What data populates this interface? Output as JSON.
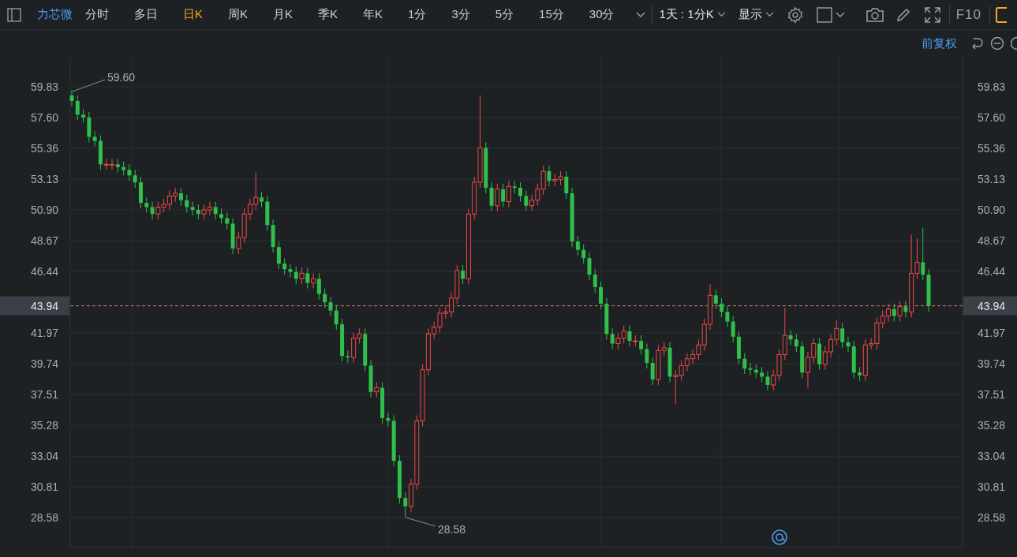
{
  "toolbar": {
    "stock_name": "力芯微",
    "tabs": [
      {
        "label": "分时",
        "selected": false
      },
      {
        "label": "多日",
        "selected": false
      },
      {
        "label": "日K",
        "selected": true
      },
      {
        "label": "周K",
        "selected": false
      },
      {
        "label": "月K",
        "selected": false
      },
      {
        "label": "季K",
        "selected": false
      },
      {
        "label": "年K",
        "selected": false
      },
      {
        "label": "1分",
        "selected": false
      },
      {
        "label": "3分",
        "selected": false
      },
      {
        "label": "5分",
        "selected": false
      },
      {
        "label": "15分",
        "selected": false
      },
      {
        "label": "30分",
        "selected": false
      }
    ],
    "dropdowns": [
      "1天 : 1分K",
      "显示"
    ],
    "f10": "F10"
  },
  "adjustment": "前复权",
  "chart": {
    "price_labels": [
      "43.94"
    ],
    "right_axis_labels": [
      "59.83",
      "57.60",
      "55.36",
      "53.13",
      "50.90",
      "48.67",
      "46.44",
      "41.97",
      "39.74",
      "37.51",
      "35.28",
      "33.04",
      "30.81",
      "28.58"
    ],
    "chart_data": {
      "type": "candlestick",
      "grid": true,
      "yticks": [
        {
          "value": 59.83,
          "label": "59.83"
        },
        {
          "value": 57.6,
          "label": "57.60"
        },
        {
          "value": 55.36,
          "label": "55.36"
        },
        {
          "value": 53.13,
          "label": "53.13"
        },
        {
          "value": 50.9,
          "label": "50.90"
        },
        {
          "value": 48.67,
          "label": "48.67"
        },
        {
          "value": 46.44,
          "label": "46.44"
        },
        {
          "value": 41.97,
          "label": "41.97"
        },
        {
          "value": 39.74,
          "label": "39.74"
        },
        {
          "value": 37.51,
          "label": "37.51"
        },
        {
          "value": 35.28,
          "label": "35.28"
        },
        {
          "value": 33.04,
          "label": "33.04"
        },
        {
          "value": 30.81,
          "label": "30.81"
        },
        {
          "value": 28.58,
          "label": "28.58"
        }
      ],
      "ref_lines": [
        {
          "axis": "y",
          "value": 43.94,
          "label": "43.94",
          "color": "#c8856a"
        }
      ],
      "ylim": [
        26.41,
        62.0
      ],
      "ohlc": [
        [
          59.2,
          59.6,
          58.4,
          58.8
        ],
        [
          58.8,
          59.2,
          57.4,
          57.8
        ],
        [
          57.8,
          58.2,
          57.2,
          57.6
        ],
        [
          57.6,
          58.0,
          55.8,
          56.2
        ],
        [
          56.2,
          56.6,
          55.5,
          55.9
        ],
        [
          55.9,
          56.3,
          53.8,
          54.2
        ],
        [
          54.2,
          54.6,
          53.8,
          54.2
        ],
        [
          54.2,
          54.6,
          53.8,
          54.2
        ],
        [
          54.2,
          54.6,
          53.6,
          54.0
        ],
        [
          54.0,
          54.4,
          53.4,
          53.8
        ],
        [
          53.8,
          54.2,
          53.0,
          53.4
        ],
        [
          53.4,
          53.8,
          52.5,
          52.9
        ],
        [
          52.9,
          53.3,
          51.0,
          51.4
        ],
        [
          51.4,
          51.8,
          50.7,
          51.1
        ],
        [
          51.1,
          51.5,
          50.2,
          50.6
        ],
        [
          50.6,
          51.5,
          50.2,
          51.1
        ],
        [
          51.1,
          51.7,
          50.7,
          51.3
        ],
        [
          51.3,
          52.3,
          50.9,
          51.9
        ],
        [
          51.9,
          52.5,
          51.5,
          52.1
        ],
        [
          52.1,
          52.5,
          51.2,
          51.6
        ],
        [
          51.6,
          52.0,
          50.7,
          51.1
        ],
        [
          51.1,
          51.5,
          50.5,
          50.9
        ],
        [
          50.9,
          51.3,
          50.2,
          50.6
        ],
        [
          50.6,
          51.3,
          50.2,
          50.9
        ],
        [
          50.9,
          51.5,
          50.5,
          51.1
        ],
        [
          51.1,
          51.5,
          50.2,
          50.6
        ],
        [
          50.6,
          51.0,
          49.9,
          50.3
        ],
        [
          50.3,
          50.7,
          49.5,
          49.9
        ],
        [
          49.9,
          50.3,
          47.7,
          48.1
        ],
        [
          48.1,
          49.3,
          47.7,
          48.9
        ],
        [
          48.9,
          51.0,
          48.5,
          50.6
        ],
        [
          50.6,
          51.7,
          50.2,
          51.3
        ],
        [
          51.3,
          53.6,
          50.9,
          51.8
        ],
        [
          51.8,
          52.2,
          51.1,
          51.5
        ],
        [
          51.5,
          51.9,
          49.4,
          49.8
        ],
        [
          49.8,
          50.2,
          47.8,
          48.2
        ],
        [
          48.2,
          48.6,
          46.6,
          47.0
        ],
        [
          47.0,
          47.4,
          46.2,
          46.6
        ],
        [
          46.6,
          47.0,
          46.0,
          46.4
        ],
        [
          46.4,
          46.8,
          45.5,
          45.9
        ],
        [
          45.9,
          46.7,
          45.5,
          46.3
        ],
        [
          46.3,
          46.7,
          45.2,
          45.6
        ],
        [
          45.6,
          46.3,
          45.2,
          45.9
        ],
        [
          45.9,
          46.3,
          44.4,
          44.8
        ],
        [
          44.8,
          45.2,
          43.8,
          44.2
        ],
        [
          44.2,
          44.6,
          43.2,
          43.6
        ],
        [
          43.6,
          44.0,
          42.2,
          42.6
        ],
        [
          42.6,
          43.0,
          39.9,
          40.3
        ],
        [
          40.3,
          40.7,
          39.8,
          40.2
        ],
        [
          40.2,
          42.0,
          39.8,
          41.6
        ],
        [
          41.6,
          42.3,
          41.2,
          41.9
        ],
        [
          41.9,
          42.3,
          39.2,
          39.6
        ],
        [
          39.6,
          40.0,
          37.3,
          37.7
        ],
        [
          37.7,
          38.4,
          37.3,
          38.0
        ],
        [
          38.0,
          38.4,
          35.4,
          35.8
        ],
        [
          35.8,
          36.2,
          35.2,
          35.6
        ],
        [
          35.6,
          36.0,
          32.3,
          32.7
        ],
        [
          32.7,
          33.1,
          29.6,
          30.0
        ],
        [
          30.0,
          30.4,
          28.58,
          29.4
        ],
        [
          29.4,
          31.4,
          29.0,
          31.0
        ],
        [
          31.0,
          36.0,
          30.6,
          35.6
        ],
        [
          35.6,
          39.7,
          35.2,
          39.3
        ],
        [
          39.3,
          42.3,
          38.9,
          41.9
        ],
        [
          41.9,
          42.8,
          41.5,
          42.4
        ],
        [
          42.4,
          43.8,
          42.0,
          43.4
        ],
        [
          43.4,
          43.9,
          43.0,
          43.5
        ],
        [
          43.5,
          44.9,
          43.1,
          44.5
        ],
        [
          44.5,
          46.9,
          44.1,
          46.5
        ],
        [
          46.5,
          46.9,
          45.5,
          45.9
        ],
        [
          45.9,
          51.0,
          45.5,
          50.6
        ],
        [
          50.6,
          53.3,
          50.2,
          52.9
        ],
        [
          52.9,
          59.2,
          52.5,
          55.4
        ],
        [
          55.4,
          55.8,
          52.1,
          52.5
        ],
        [
          52.5,
          52.9,
          50.8,
          51.2
        ],
        [
          51.2,
          52.8,
          50.8,
          52.4
        ],
        [
          52.4,
          52.8,
          51.1,
          51.5
        ],
        [
          51.5,
          53.0,
          51.1,
          52.6
        ],
        [
          52.6,
          53.0,
          52.1,
          52.5
        ],
        [
          52.5,
          52.9,
          51.5,
          51.9
        ],
        [
          51.9,
          52.3,
          50.8,
          51.2
        ],
        [
          51.2,
          52.0,
          50.8,
          51.6
        ],
        [
          51.6,
          52.8,
          51.2,
          52.4
        ],
        [
          52.4,
          54.1,
          52.0,
          53.7
        ],
        [
          53.7,
          54.1,
          52.6,
          53.0
        ],
        [
          53.0,
          53.5,
          52.6,
          53.1
        ],
        [
          53.1,
          53.7,
          52.7,
          53.3
        ],
        [
          53.3,
          53.7,
          51.7,
          52.1
        ],
        [
          52.1,
          52.5,
          48.2,
          48.6
        ],
        [
          48.6,
          49.0,
          47.6,
          48.0
        ],
        [
          48.0,
          48.4,
          47.0,
          47.4
        ],
        [
          47.4,
          47.8,
          45.8,
          46.2
        ],
        [
          46.2,
          46.6,
          44.9,
          45.3
        ],
        [
          45.3,
          45.7,
          43.7,
          44.1
        ],
        [
          44.1,
          44.5,
          41.5,
          41.9
        ],
        [
          41.9,
          42.3,
          40.8,
          41.2
        ],
        [
          41.2,
          42.0,
          40.8,
          41.6
        ],
        [
          41.6,
          42.5,
          41.2,
          42.1
        ],
        [
          42.1,
          42.5,
          41.0,
          41.4
        ],
        [
          41.4,
          41.8,
          41.0,
          41.4
        ],
        [
          41.4,
          41.8,
          40.4,
          40.8
        ],
        [
          40.8,
          41.2,
          39.4,
          39.8
        ],
        [
          39.8,
          40.2,
          38.2,
          38.6
        ],
        [
          38.6,
          41.1,
          38.2,
          40.7
        ],
        [
          40.7,
          41.3,
          40.3,
          40.9
        ],
        [
          40.9,
          41.3,
          38.4,
          38.8
        ],
        [
          38.8,
          39.3,
          36.8,
          38.9
        ],
        [
          38.9,
          40.0,
          38.5,
          39.6
        ],
        [
          39.6,
          40.5,
          39.2,
          40.1
        ],
        [
          40.1,
          40.8,
          39.7,
          40.4
        ],
        [
          40.4,
          41.5,
          40.0,
          41.1
        ],
        [
          41.1,
          43.0,
          40.7,
          42.6
        ],
        [
          42.6,
          45.5,
          42.2,
          44.7
        ],
        [
          44.7,
          45.1,
          43.7,
          44.1
        ],
        [
          44.1,
          44.5,
          43.1,
          43.5
        ],
        [
          43.5,
          43.9,
          42.4,
          42.8
        ],
        [
          42.8,
          43.2,
          41.3,
          41.7
        ],
        [
          41.7,
          42.1,
          39.7,
          40.1
        ],
        [
          40.1,
          40.5,
          39.0,
          39.4
        ],
        [
          39.4,
          39.8,
          38.9,
          39.3
        ],
        [
          39.3,
          39.7,
          38.7,
          39.1
        ],
        [
          39.1,
          39.5,
          38.4,
          38.8
        ],
        [
          38.8,
          39.2,
          37.8,
          38.2
        ],
        [
          38.2,
          39.3,
          37.8,
          38.9
        ],
        [
          38.9,
          40.8,
          38.5,
          40.4
        ],
        [
          40.4,
          43.8,
          40.0,
          41.8
        ],
        [
          41.8,
          42.2,
          41.1,
          41.5
        ],
        [
          41.5,
          41.9,
          40.6,
          41.0
        ],
        [
          41.0,
          41.4,
          38.7,
          39.1
        ],
        [
          39.1,
          40.6,
          38.0,
          40.2
        ],
        [
          40.2,
          41.6,
          39.8,
          41.2
        ],
        [
          41.2,
          41.6,
          39.3,
          39.7
        ],
        [
          39.7,
          41.0,
          39.3,
          40.6
        ],
        [
          40.6,
          41.9,
          40.2,
          41.5
        ],
        [
          41.5,
          42.9,
          41.1,
          42.3
        ],
        [
          42.3,
          42.7,
          40.9,
          41.3
        ],
        [
          41.3,
          41.7,
          40.6,
          41.0
        ],
        [
          41.0,
          41.4,
          38.7,
          39.1
        ],
        [
          39.1,
          39.5,
          38.5,
          38.9
        ],
        [
          38.9,
          41.5,
          38.5,
          41.1
        ],
        [
          41.1,
          41.6,
          40.8,
          41.2
        ],
        [
          41.2,
          43.1,
          40.8,
          42.7
        ],
        [
          42.7,
          43.6,
          42.3,
          43.2
        ],
        [
          43.2,
          44.1,
          42.8,
          43.7
        ],
        [
          43.7,
          44.1,
          42.8,
          43.2
        ],
        [
          43.2,
          44.3,
          42.8,
          43.9
        ],
        [
          43.9,
          44.3,
          43.1,
          43.5
        ],
        [
          43.5,
          49.1,
          43.1,
          46.3
        ],
        [
          46.3,
          48.8,
          45.9,
          47.1
        ],
        [
          47.1,
          49.6,
          45.8,
          46.2
        ],
        [
          46.2,
          46.6,
          43.5,
          43.94
        ]
      ],
      "annotations": [
        {
          "text": "59.60"
        },
        {
          "text": "28.58"
        }
      ]
    }
  }
}
